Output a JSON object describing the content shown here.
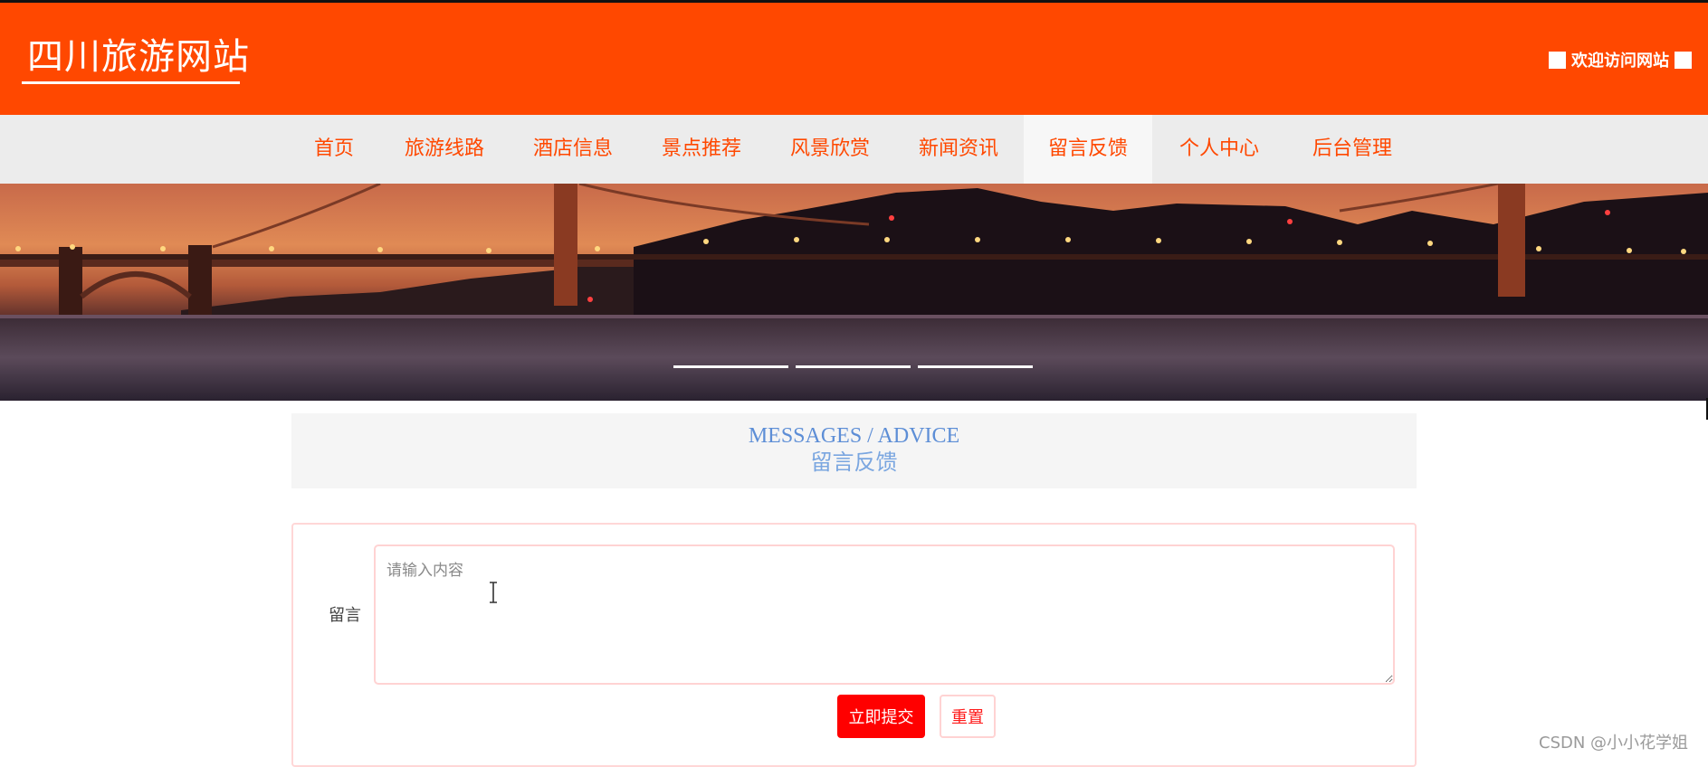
{
  "header": {
    "site_title": "四川旅游网站",
    "welcome_text": "欢迎访问网站",
    "background_color": "#ff4800"
  },
  "nav": {
    "items": [
      {
        "label": "首页"
      },
      {
        "label": "旅游线路"
      },
      {
        "label": "酒店信息"
      },
      {
        "label": "景点推荐"
      },
      {
        "label": "风景欣赏"
      },
      {
        "label": "新闻资讯"
      },
      {
        "label": "留言反馈",
        "active": true
      },
      {
        "label": "个人中心"
      },
      {
        "label": "后台管理"
      }
    ],
    "text_color": "#ff4800"
  },
  "banner": {
    "description_icon": "golden-gate-bridge-night-photo",
    "slide_count": 3
  },
  "section": {
    "title_en": "MESSAGES / ADVICE",
    "title_cn": "留言反馈"
  },
  "form": {
    "message_label": "留言",
    "message_placeholder": "请输入内容",
    "message_value": "",
    "submit_label": "立即提交",
    "reset_label": "重置",
    "accent_color": "#ff0000"
  },
  "watermark": "CSDN @小小花学姐"
}
